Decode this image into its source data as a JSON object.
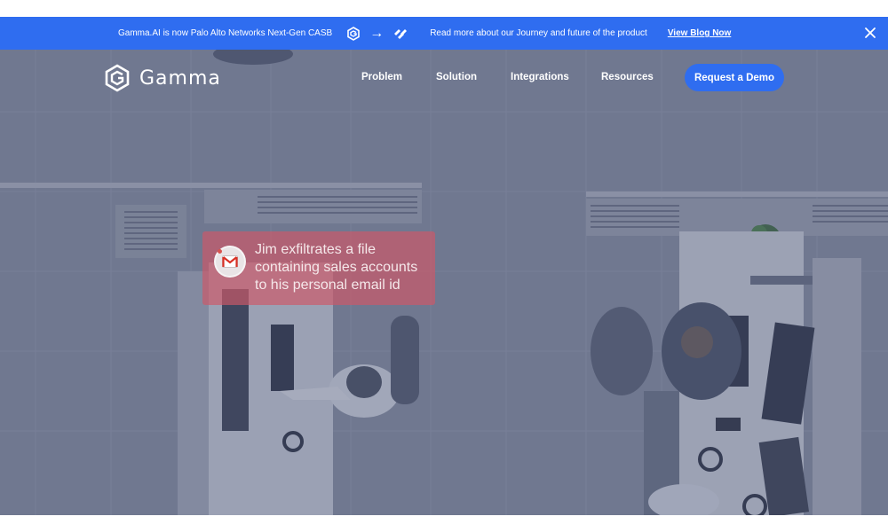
{
  "announcement": {
    "text": "Gamma.AI is now Palo Alto Networks Next-Gen CASB",
    "arrow": "→",
    "blog_text": "Read more about our Journey and future of the product",
    "link_label": "View Blog Now",
    "icons": [
      "gamma-icon",
      "arrow-right-icon",
      "palo-alto-icon",
      "close-icon"
    ]
  },
  "header": {
    "logo_text": "Gamma",
    "nav": [
      "Problem",
      "Solution",
      "Integrations",
      "Resources"
    ],
    "cta_label": "Request a Demo"
  },
  "alert": {
    "message": "Jim exfiltrates a file containing sales accounts to his personal email id",
    "icon": "gmail-icon"
  },
  "colors": {
    "brand_blue": "#2f6df0",
    "alert_red": "#cd5868"
  }
}
